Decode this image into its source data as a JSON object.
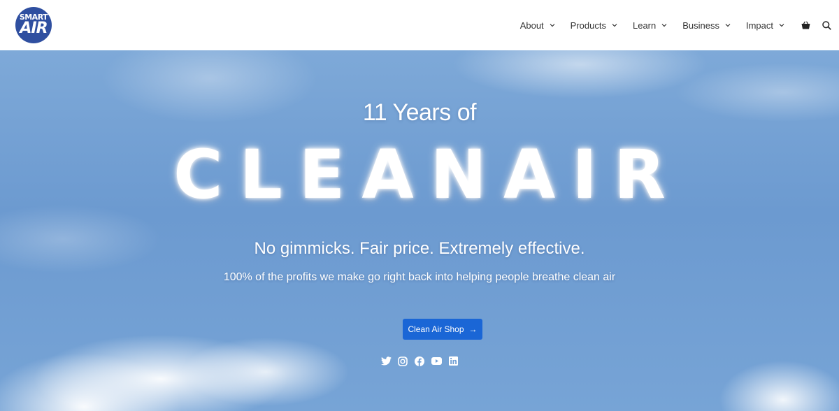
{
  "logo": {
    "line1": "SMART",
    "line2": "AIR",
    "color": "#2f4fa0"
  },
  "nav": {
    "items": [
      {
        "label": "About",
        "icon": "chevron-down-icon"
      },
      {
        "label": "Products",
        "icon": "chevron-down-icon"
      },
      {
        "label": "Learn",
        "icon": "chevron-down-icon"
      },
      {
        "label": "Business",
        "icon": "chevron-down-icon"
      },
      {
        "label": "Impact",
        "icon": "chevron-down-icon"
      }
    ],
    "cart_icon": "shopping-bag-icon",
    "search_icon": "search-icon"
  },
  "hero": {
    "title": "11 Years of",
    "cloud_text": "CLEANAIR",
    "subtitle": "No gimmicks. Fair price. Extremely effective.",
    "description": "100% of the profits we make go right back into helping people breathe clean air",
    "cta_label": "Clean Air Shop",
    "cta_color": "#1a66d6"
  },
  "social": [
    "twitter-icon",
    "instagram-icon",
    "facebook-icon",
    "youtube-icon",
    "linkedin-icon"
  ]
}
